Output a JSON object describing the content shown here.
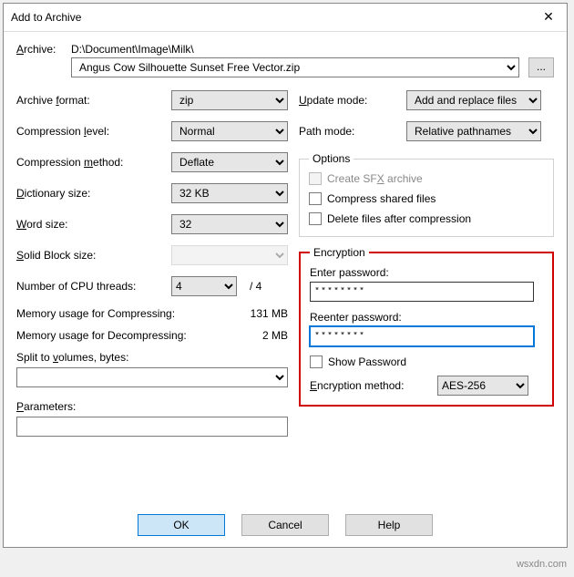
{
  "title": "Add to Archive",
  "archive_label": "Archive:",
  "archive_path": "D:\\Document\\Image\\Milk\\",
  "archive_name": "Angus Cow Silhouette Sunset Free Vector.zip",
  "browse_label": "...",
  "left": {
    "archive_format_label": "Archive format:",
    "archive_format_value": "zip",
    "compression_level_label": "Compression level:",
    "compression_level_value": "Normal",
    "compression_method_label": "Compression method:",
    "compression_method_value": "Deflate",
    "dictionary_size_label": "Dictionary size:",
    "dictionary_size_value": "32 KB",
    "word_size_label": "Word size:",
    "word_size_value": "32",
    "solid_block_label": "Solid Block size:",
    "cpu_threads_label": "Number of CPU threads:",
    "cpu_threads_value": "4",
    "cpu_threads_max": "/ 4",
    "mem_compress_label": "Memory usage for Compressing:",
    "mem_compress_value": "131 MB",
    "mem_decompress_label": "Memory usage for Decompressing:",
    "mem_decompress_value": "2 MB",
    "split_label": "Split to volumes, bytes:",
    "parameters_label": "Parameters:"
  },
  "right": {
    "update_mode_label": "Update mode:",
    "update_mode_value": "Add and replace files",
    "path_mode_label": "Path mode:",
    "path_mode_value": "Relative pathnames",
    "options_legend": "Options",
    "sfx_label": "Create SFX archive",
    "compress_shared_label": "Compress shared files",
    "delete_after_label": "Delete files after compression",
    "encryption_legend": "Encryption",
    "enter_password_label": "Enter password:",
    "password_value": "********",
    "reenter_password_label": "Reenter password:",
    "reenter_value": "********",
    "show_password_label": "Show Password",
    "enc_method_label": "Encryption method:",
    "enc_method_value": "AES-256"
  },
  "buttons": {
    "ok": "OK",
    "cancel": "Cancel",
    "help": "Help"
  },
  "watermark": "wsxdn.com"
}
